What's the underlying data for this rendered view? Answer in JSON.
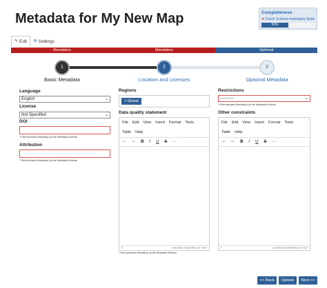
{
  "page": {
    "title": "Metadata for My New Map"
  },
  "completeness": {
    "title": "Completeness",
    "link_text": "Check Schema mandatory fields",
    "progress_label": "50%",
    "progress_fraction": 0.5
  },
  "tabs": [
    {
      "label": "Edit",
      "icon": "pencil-icon",
      "active": true
    },
    {
      "label": "Settings",
      "icon": "gear-icon",
      "active": false
    }
  ],
  "requirement_bar": [
    {
      "label": "Mandatory",
      "color": "#b81c1c"
    },
    {
      "label": "Mandatory",
      "color": "#b81c1c"
    },
    {
      "label": "Optional",
      "color": "#2f5f97"
    }
  ],
  "steps": [
    {
      "number": "1",
      "label": "Basic Metadata"
    },
    {
      "number": "2",
      "label": "Location and Licenses"
    },
    {
      "number": "3",
      "label": "Optional Metadata"
    }
  ],
  "basic": {
    "language_label": "Language",
    "language_value": "English",
    "license_label": "License",
    "license_value": "Not Specified",
    "doi_label": "DOI",
    "doi_hint": "* Field declared Mandatory by the Metadata Schema",
    "attribution_label": "Attribution",
    "attribution_hint": "* Field declared Mandatory by the Metadata Schema"
  },
  "location": {
    "regions_label": "Regions",
    "region_chip": "Global",
    "dq_label": "Data quality statement",
    "dq_hint": "* Field declared Mandatory by the Metadata Schema"
  },
  "optional": {
    "restrictions_label": "Restrictions",
    "restrictions_value": "----------",
    "restrictions_hint": "* Field declared Mandatory by the Metadata Schema",
    "other_label": "Other constraints"
  },
  "editor": {
    "menu": [
      "File",
      "Edit",
      "View",
      "Insert",
      "Format",
      "Tools"
    ],
    "menu2": [
      "Table",
      "Help"
    ],
    "status_left": "P",
    "status_right": "0 WORDS  POWERED BY TINY"
  },
  "buttons": {
    "back": "<< Back",
    "update": "Update",
    "next": "Next >>"
  }
}
